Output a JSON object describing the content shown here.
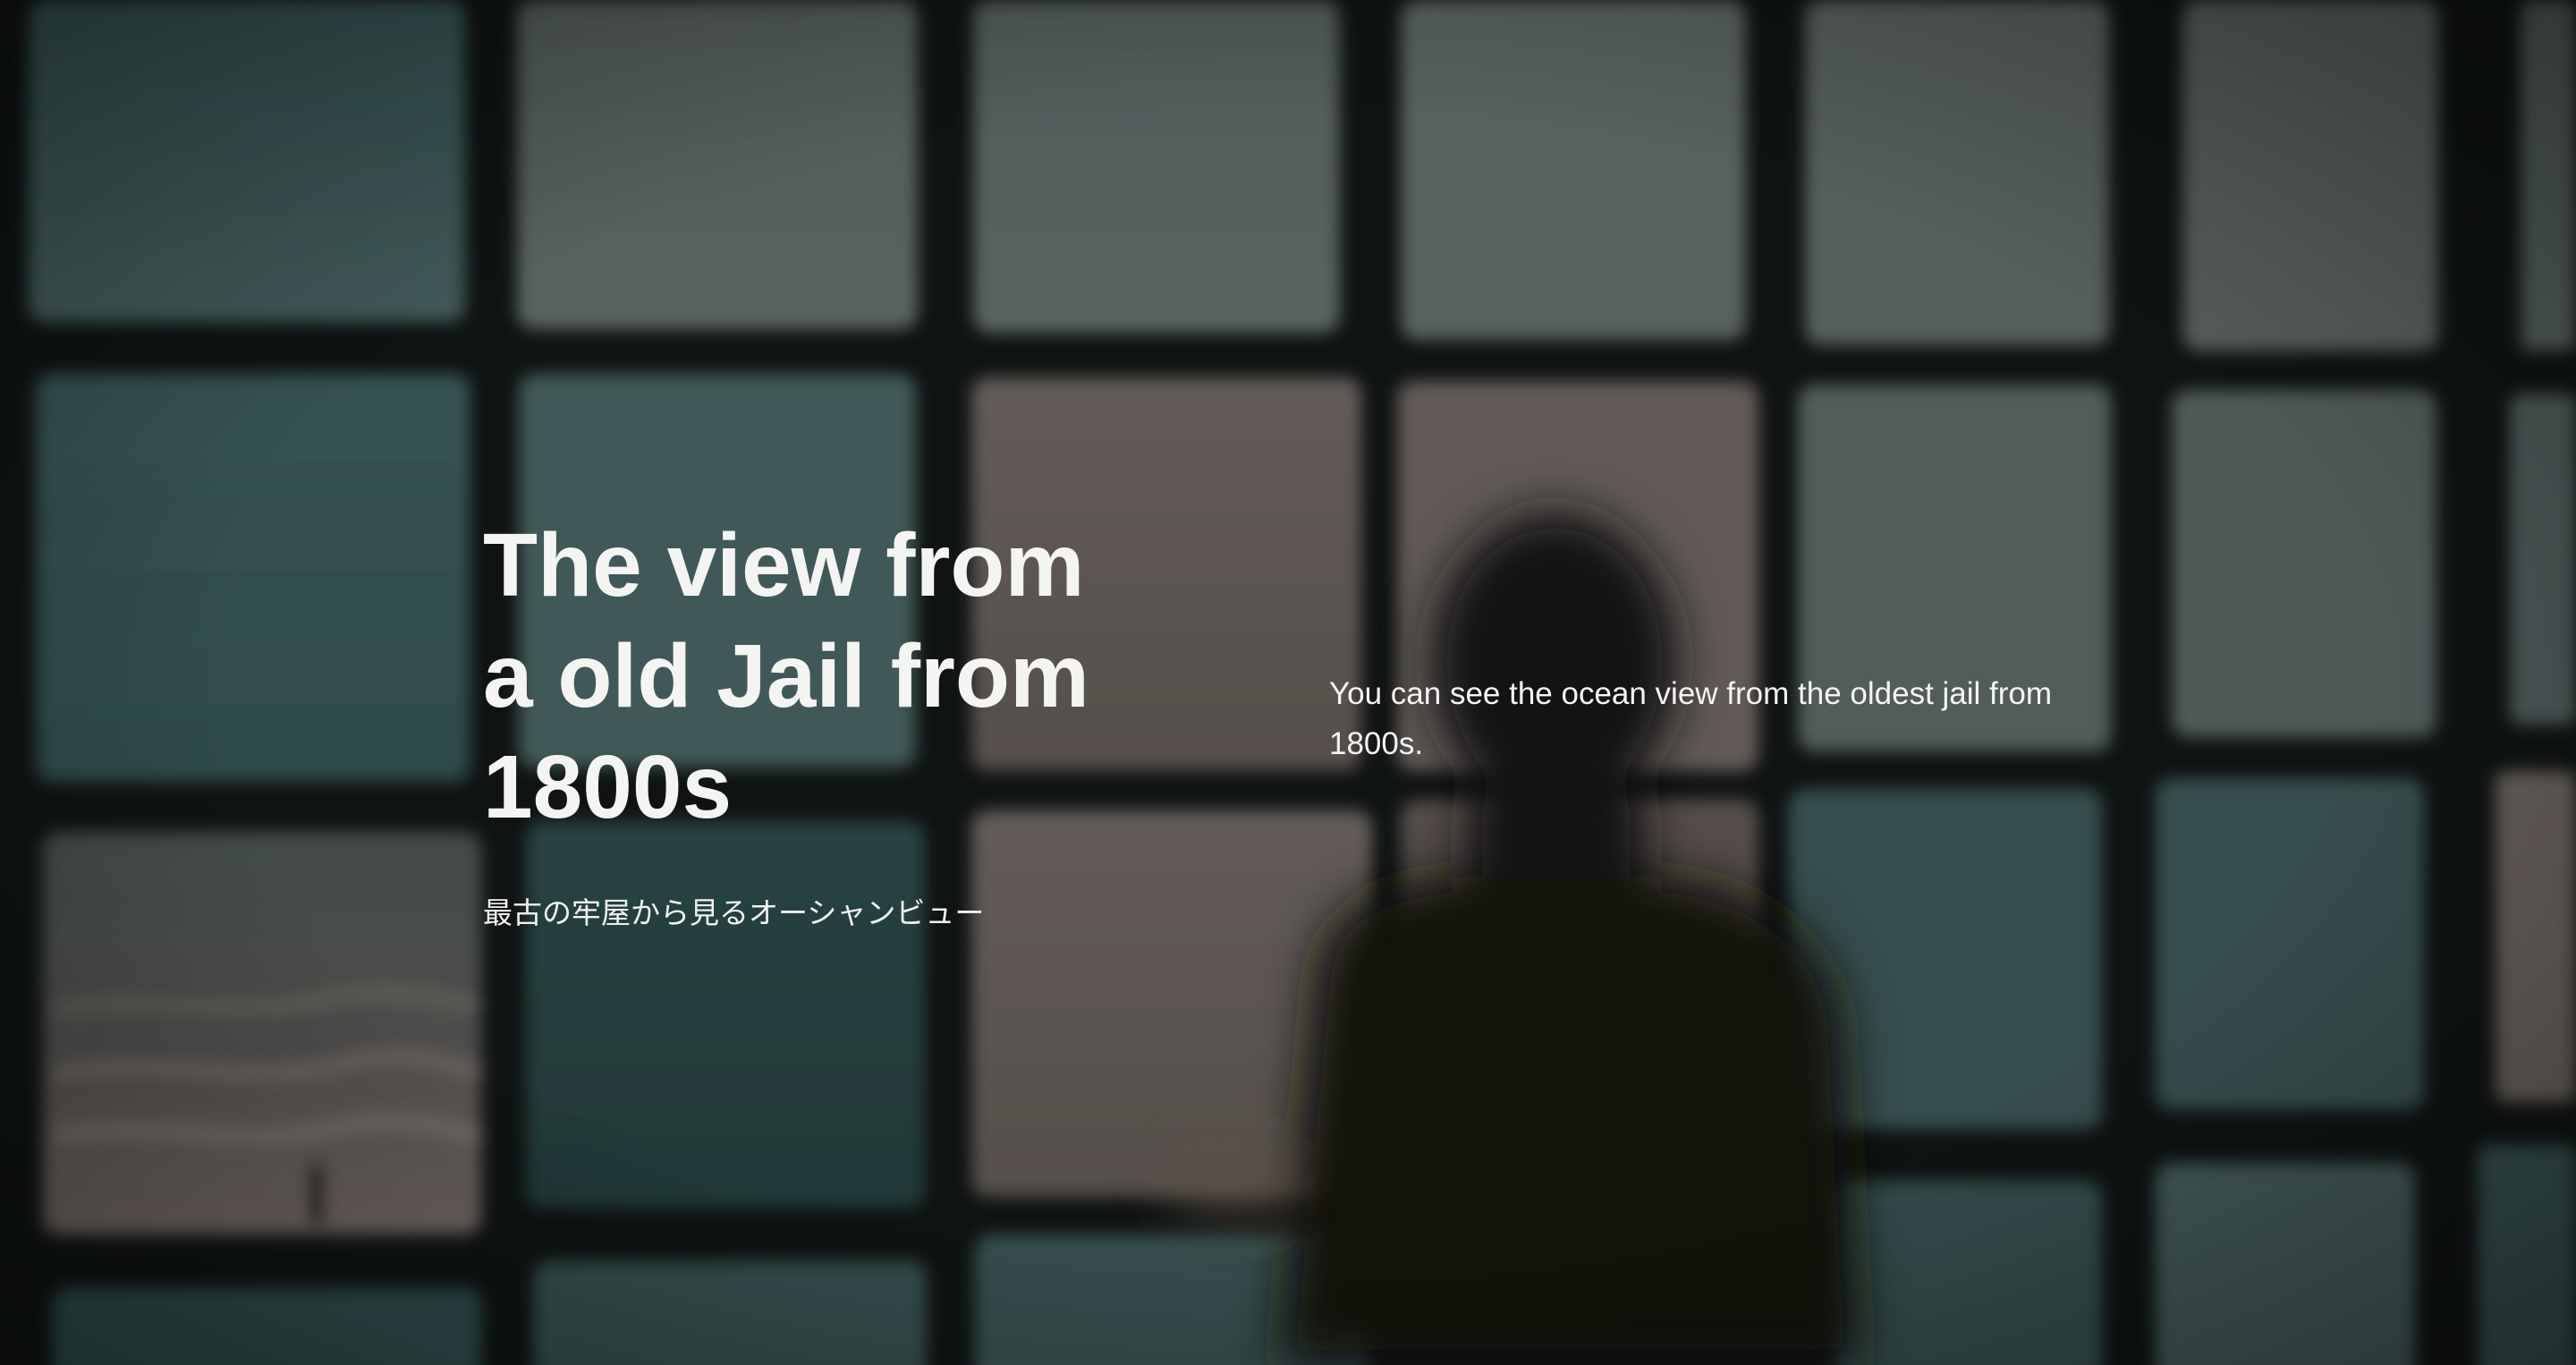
{
  "hero": {
    "headline_lines": [
      "The view from",
      "a old Jail from",
      "1800s"
    ],
    "subtitle": "最古の牢屋から見るオーシャンビュー",
    "description": "You can see the ocean view from the oldest jail from 1800s.",
    "background_image": "blurred-photo-person-silhouette-behind-jail-window-grid-ocean-view",
    "colors": {
      "text": "#f4f4f3",
      "teal_pane": "#3c5c5c",
      "ocean_pane": "#6b6360",
      "grid_bars": "#121716"
    }
  }
}
